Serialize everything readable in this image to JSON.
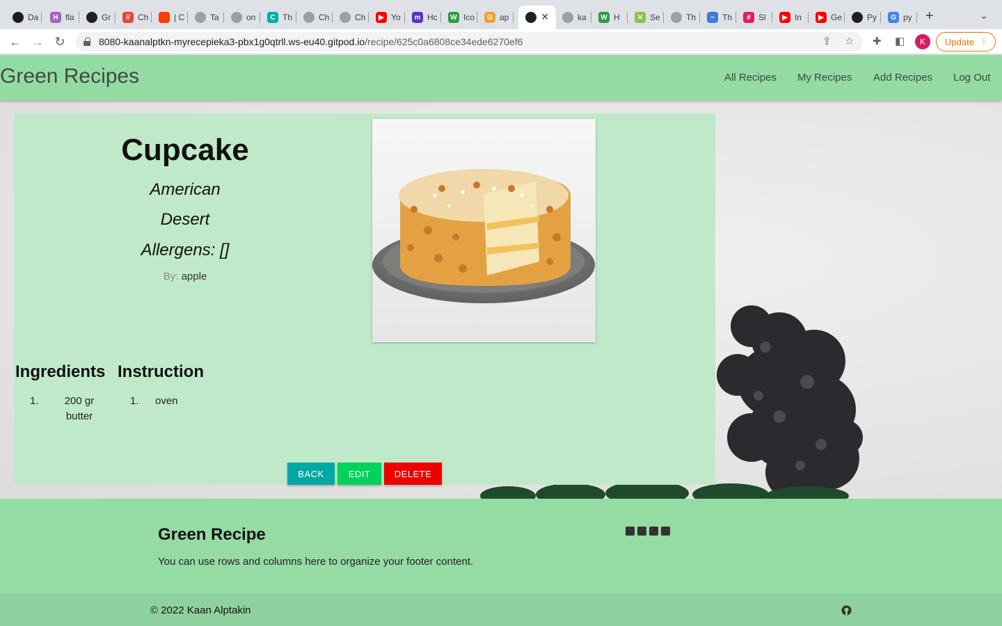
{
  "browser": {
    "tabs": [
      {
        "label": "Da",
        "favicon_color": "#1e1e1e",
        "glyph": ""
      },
      {
        "label": "fla",
        "favicon_color": "#a463bf",
        "glyph": "H"
      },
      {
        "label": "Gr",
        "favicon_color": "#202124",
        "glyph": ""
      },
      {
        "label": "Ch",
        "favicon_color": "#e8453c",
        "glyph": "//"
      },
      {
        "label": "| C",
        "favicon_color": "#ff3d00",
        "glyph": ""
      },
      {
        "label": "Ta",
        "favicon_color": "#9aa0a6",
        "glyph": ""
      },
      {
        "label": "on",
        "favicon_color": "#9aa0a6",
        "glyph": ""
      },
      {
        "label": "Th",
        "favicon_color": "#00b3a6",
        "glyph": "C"
      },
      {
        "label": "Ch",
        "favicon_color": "#9aa0a6",
        "glyph": ""
      },
      {
        "label": "Ch",
        "favicon_color": "#9aa0a6",
        "glyph": ""
      },
      {
        "label": "Yo",
        "favicon_color": "#ff0000",
        "glyph": "▶"
      },
      {
        "label": "Hc",
        "favicon_color": "#5b2ecc",
        "glyph": "m"
      },
      {
        "label": "Ico",
        "favicon_color": "#2a9d43",
        "glyph": "W"
      },
      {
        "label": "ap",
        "favicon_color": "#f4a12c",
        "glyph": "G"
      },
      {
        "label": "",
        "favicon_color": "#202124",
        "glyph": "",
        "active": true
      },
      {
        "label": "ka",
        "favicon_color": "#9aa0a6",
        "glyph": ""
      },
      {
        "label": "H",
        "favicon_color": "#2a9d43",
        "glyph": "W"
      },
      {
        "label": "Se",
        "favicon_color": "#8bc34a",
        "glyph": "✕"
      },
      {
        "label": "Th",
        "favicon_color": "#9aa0a6",
        "glyph": ""
      },
      {
        "label": "Th",
        "favicon_color": "#3f7bd9",
        "glyph": "~"
      },
      {
        "label": "Sl",
        "favicon_color": "#e01e5a",
        "glyph": "#"
      },
      {
        "label": "In",
        "favicon_color": "#ff0000",
        "glyph": "▶"
      },
      {
        "label": "Ge",
        "favicon_color": "#ff0000",
        "glyph": "▶"
      },
      {
        "label": "Py",
        "favicon_color": "#202124",
        "glyph": ""
      },
      {
        "label": "py",
        "favicon_color": "#4285f4",
        "glyph": "G"
      }
    ],
    "url_host": "8080-kaanalptkn-myrecepieka3-pbx1g0qtrll.ws-eu40.gitpod.io",
    "url_path": "/recipe/625c0a6808ce34ede6270ef6",
    "profile_initial": "K",
    "update_label": "Update",
    "accent_color": "#e37400"
  },
  "nav": {
    "brand": "Green Recipes",
    "links": [
      "All Recipes",
      "My Recipes",
      "Add Recipes",
      "Log Out"
    ]
  },
  "recipe": {
    "title": "Cupcake",
    "cuisine": "American",
    "category": "Desert",
    "allergens": "Allergens: []",
    "by_label": "By:",
    "author": "apple",
    "image_icon": "cake-photo",
    "ingredients_heading": "Ingredients",
    "instruction_heading": "Instruction",
    "ingredients": [
      {
        "num": "1.",
        "text": "200 gr butter"
      }
    ],
    "instructions": [
      {
        "num": "1.",
        "text": "oven"
      }
    ]
  },
  "buttons": {
    "back": "BACK",
    "edit": "EDIT",
    "delete": "DELETE",
    "back_color": "#00a8a3",
    "edit_color": "#00d25b",
    "delete_color": "#ef0000"
  },
  "footer": {
    "title": "Green Recipe",
    "text": "You can use rows and columns here to organize your footer content.",
    "social_icons": [
      "facebook-icon",
      "instagram-icon",
      "twitter-icon",
      "youtube-icon"
    ],
    "copyright": "© 2022 Kaan Alptakin",
    "github_icon": "github-icon",
    "bg_color": "#95dba4"
  }
}
